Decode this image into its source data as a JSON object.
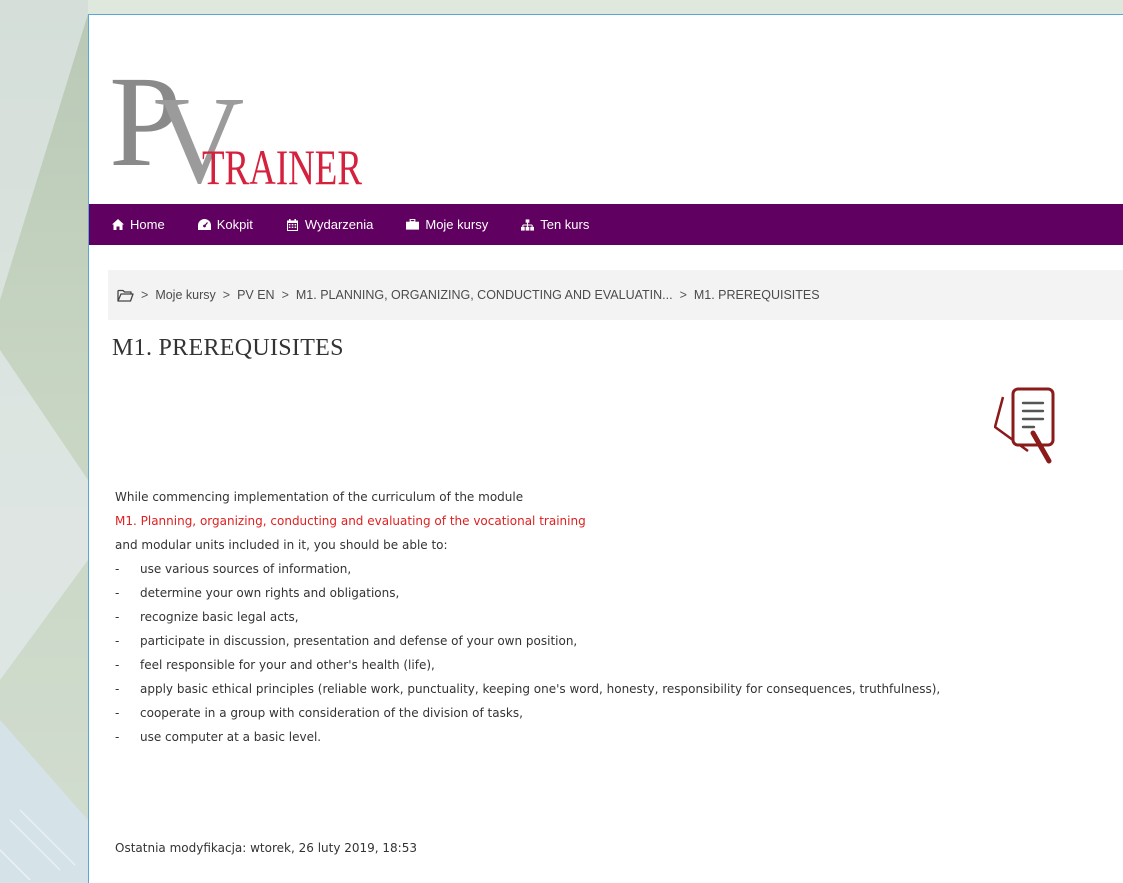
{
  "logo": {
    "monogram": "PV",
    "word": "TRAINER"
  },
  "navbar": {
    "items": [
      {
        "label": "Home",
        "icon": "home-icon"
      },
      {
        "label": "Kokpit",
        "icon": "dashboard-icon"
      },
      {
        "label": "Wydarzenia",
        "icon": "calendar-icon"
      },
      {
        "label": "Moje kursy",
        "icon": "briefcase-icon"
      },
      {
        "label": "Ten kurs",
        "icon": "sitemap-icon"
      }
    ]
  },
  "breadcrumb": {
    "items": [
      "Moje kursy",
      "PV EN",
      "M1. PLANNING, ORGANIZING, CONDUCTING AND EVALUATIN...",
      "M1. PREREQUISITES"
    ],
    "separator": ">"
  },
  "page": {
    "title": "M1. PREREQUISITES",
    "intro": "While commencing implementation of the curriculum of the module",
    "module_name": "M1. Planning, organizing, conducting and evaluating of the vocational training",
    "lead": "and modular units included in it, you should be able to:",
    "bullet_marker": "-",
    "prerequisites": [
      "use various sources of information,",
      "determine your own rights and obligations,",
      "recognize basic legal acts,",
      "participate in discussion, presentation and defense of your own position,",
      "feel responsible for your and other's health (life),",
      "apply basic ethical principles (reliable work, punctuality, keeping one's word, honesty, responsibility for consequences, truthfulness),",
      "cooperate in a group with consideration of the division of tasks,",
      "use computer at a basic level."
    ],
    "last_modified": "Ostatnia modyfikacja: wtorek, 26 luty 2019, 18:53"
  },
  "colors": {
    "navbar": "#600060",
    "accent_red": "#e02020",
    "icon_dark_red": "#8b1a1a",
    "panel_border": "#5aa6d6"
  }
}
